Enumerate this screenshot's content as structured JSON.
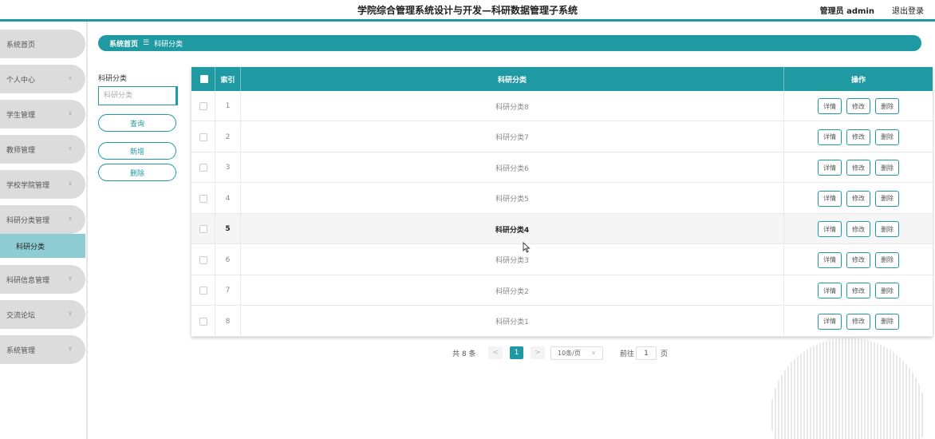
{
  "header": {
    "title": "学院综合管理系统设计与开发—科研数据管理子系统",
    "user": "管理员 admin",
    "logout": "退出登录"
  },
  "sidebar": {
    "items": [
      {
        "label": "系统首页"
      },
      {
        "label": "个人中心",
        "chevron": "down"
      },
      {
        "label": "学生管理",
        "chevron": "down"
      },
      {
        "label": "教师管理",
        "chevron": "down"
      },
      {
        "label": "学校学院管理",
        "chevron": "down"
      },
      {
        "label": "科研分类管理",
        "chevron": "up"
      },
      {
        "label": "科研信息管理",
        "chevron": "down"
      },
      {
        "label": "交流论坛",
        "chevron": "down"
      },
      {
        "label": "系统管理",
        "chevron": "down"
      }
    ],
    "active_sub": "科研分类"
  },
  "breadcrumb": {
    "home": "系统首页",
    "separator": "☰",
    "current": "科研分类"
  },
  "filter": {
    "label": "科研分类",
    "placeholder": "科研分类",
    "query_button": "查询",
    "add_button": "新增",
    "delete_button": "删除"
  },
  "table": {
    "columns": {
      "index": "索引",
      "category": "科研分类",
      "actions": "操作"
    },
    "action_labels": {
      "detail": "详情",
      "edit": "修改",
      "delete": "删除"
    },
    "rows": [
      {
        "index": "1",
        "category": "科研分类8"
      },
      {
        "index": "2",
        "category": "科研分类7"
      },
      {
        "index": "3",
        "category": "科研分类6"
      },
      {
        "index": "4",
        "category": "科研分类5"
      },
      {
        "index": "5",
        "category": "科研分类4"
      },
      {
        "index": "6",
        "category": "科研分类3"
      },
      {
        "index": "7",
        "category": "科研分类2"
      },
      {
        "index": "8",
        "category": "科研分类1"
      }
    ],
    "highlighted_row": 4
  },
  "pagination": {
    "total": "共 8 条",
    "prev": "<",
    "current_page": "1",
    "next": ">",
    "page_size": "10条/页",
    "goto_label": "前往",
    "goto_value": "1",
    "page_unit": "页"
  },
  "colors": {
    "accent": "#1f9aa3",
    "sidebar_item": "#dcdcdc",
    "sidebar_active": "#8fcdd4"
  }
}
